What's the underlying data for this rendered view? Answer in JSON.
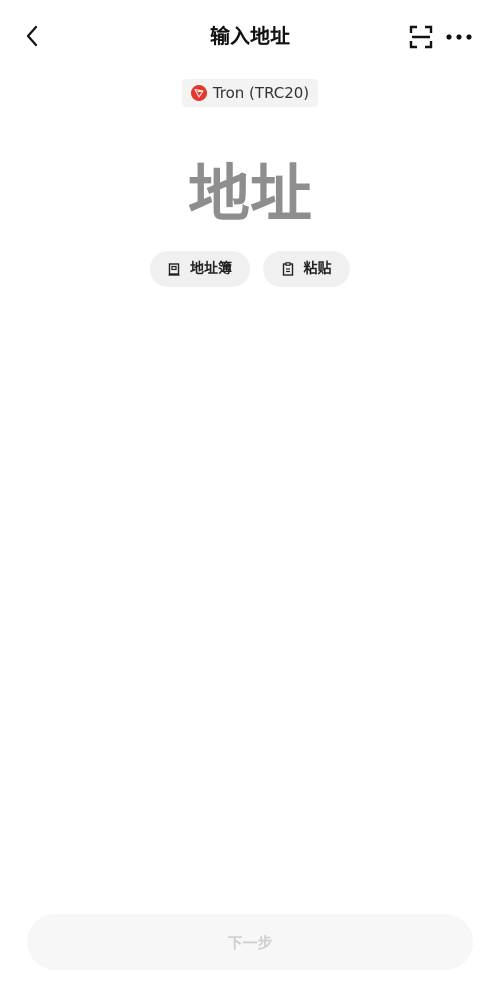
{
  "header": {
    "title": "输入地址",
    "back_icon": "chevron-left-icon",
    "scan_icon": "scan-frame-icon",
    "more_icon": "more-horizontal-icon"
  },
  "network": {
    "label": "Tron (TRC20)",
    "logo_icon": "tron-logo-icon",
    "logo_color": "#e5372b"
  },
  "address_input": {
    "value": "",
    "placeholder": "地址"
  },
  "actions": {
    "address_book_label": "地址簿",
    "address_book_icon": "book-icon",
    "paste_label": "粘贴",
    "paste_icon": "clipboard-icon"
  },
  "footer": {
    "next_label": "下一步",
    "next_enabled": false
  }
}
